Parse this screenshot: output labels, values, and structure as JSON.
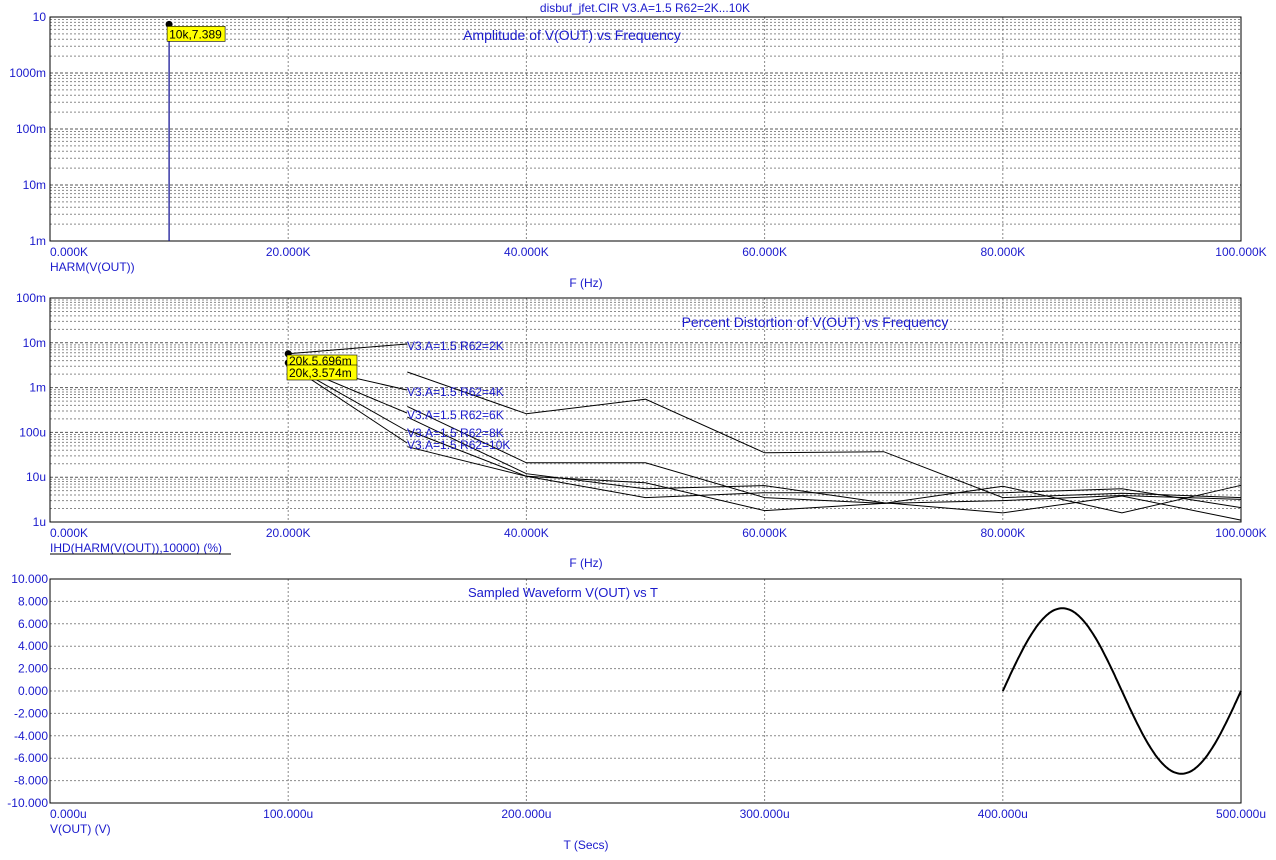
{
  "window_title": "disbuf_jfet.CIR V3.A=1.5 R62=2K...10K",
  "chart_data": [
    {
      "type": "line",
      "title": "Amplitude of V(OUT) vs Frequency",
      "xlabel": "F (Hz)",
      "ylabel": "HARM(V(OUT))",
      "x_scale": "linear",
      "y_scale": "log",
      "xlim": [
        0,
        100000
      ],
      "ylim": [
        0.001,
        10
      ],
      "x_ticks": [
        "0.000K",
        "20.000K",
        "40.000K",
        "60.000K",
        "80.000K",
        "100.000K"
      ],
      "y_ticks": [
        "10",
        "1000m",
        "100m",
        "10m",
        "1m"
      ],
      "grid": true,
      "series": [
        {
          "points": [
            [
              10000,
              0.001
            ],
            [
              10000,
              7.389
            ]
          ]
        }
      ],
      "annotations": [
        {
          "text": "10k,7.389",
          "x": 10000,
          "y": 7.389
        }
      ]
    },
    {
      "type": "line",
      "title": "Percent Distortion of V(OUT) vs Frequency",
      "xlabel": "F (Hz)",
      "ylabel": "IHD(HARM(V(OUT)),10000) (%)",
      "x_scale": "linear",
      "y_scale": "log",
      "xlim": [
        0,
        100000
      ],
      "ylim": [
        1e-06,
        0.1
      ],
      "x_ticks": [
        "0.000K",
        "20.000K",
        "40.000K",
        "60.000K",
        "80.000K",
        "100.000K"
      ],
      "y_ticks": [
        "100m",
        "10m",
        "1m",
        "100u",
        "10u",
        "1u"
      ],
      "grid": true,
      "x": [
        20000,
        30000,
        40000,
        50000,
        60000,
        70000,
        80000,
        90000,
        100000
      ],
      "series": [
        {
          "name": "V3.A=1.5 R62=2K",
          "values": [
            0.005696,
            0.00223,
            0.00026,
            0.00055,
            3.5e-05,
            3.7e-05,
            3.5e-06,
            4.4e-06,
            3.5e-06
          ]
        },
        {
          "name": "V3.A=1.5 R62=4K",
          "values": [
            0.003574,
            0.00038,
            2.1e-05,
            2.1e-05,
            3.5e-06,
            2.6e-06,
            6.3e-06,
            1.6e-06,
            6.6e-06
          ]
        },
        {
          "name": "V3.A=1.5 R62=6K",
          "values": [
            0.0035,
            0.00022,
            1.2e-05,
            5.5e-06,
            6.5e-06,
            2.7e-06,
            1.6e-06,
            3.8e-06,
            1.1e-06
          ]
        },
        {
          "name": "V3.A=1.5 R62=8K",
          "values": [
            0.0034,
            0.000113,
            1.05e-05,
            3.5e-06,
            4.5e-06,
            4.5e-06,
            4.5e-06,
            5.5e-06,
            2.1e-06
          ]
        },
        {
          "name": "V3.A=1.5 R62=10K",
          "values": [
            0.0033,
            4.8e-05,
            1.05e-05,
            7.5e-06,
            1.8e-06,
            2.6e-06,
            3e-06,
            3.9e-06,
            3.2e-06
          ]
        }
      ],
      "annotations": [
        {
          "text": "20k,5.696m",
          "x": 20000,
          "y": 0.005696
        },
        {
          "text": "20k,3.574m",
          "x": 20000,
          "y": 0.003574
        }
      ]
    },
    {
      "type": "line",
      "title": "Sampled Waveform  V(OUT) vs T",
      "xlabel": "T (Secs)",
      "ylabel": "V(OUT) (V)",
      "x_scale": "linear",
      "y_scale": "linear",
      "xlim": [
        0,
        0.0005
      ],
      "ylim": [
        -10,
        10
      ],
      "x_ticks": [
        "0.000u",
        "100.000u",
        "200.000u",
        "300.000u",
        "400.000u",
        "500.000u"
      ],
      "y_ticks": [
        "10.000",
        "8.000",
        "6.000",
        "4.000",
        "2.000",
        "0.000",
        "-2.000",
        "-4.000",
        "-6.000",
        "-8.000",
        "-10.000"
      ],
      "grid": true,
      "series": [
        {
          "name": "V(OUT)",
          "function": "sine",
          "t_start": 0.0004,
          "t_end": 0.0005,
          "amplitude": 7.389,
          "frequency": 10000
        }
      ]
    }
  ]
}
